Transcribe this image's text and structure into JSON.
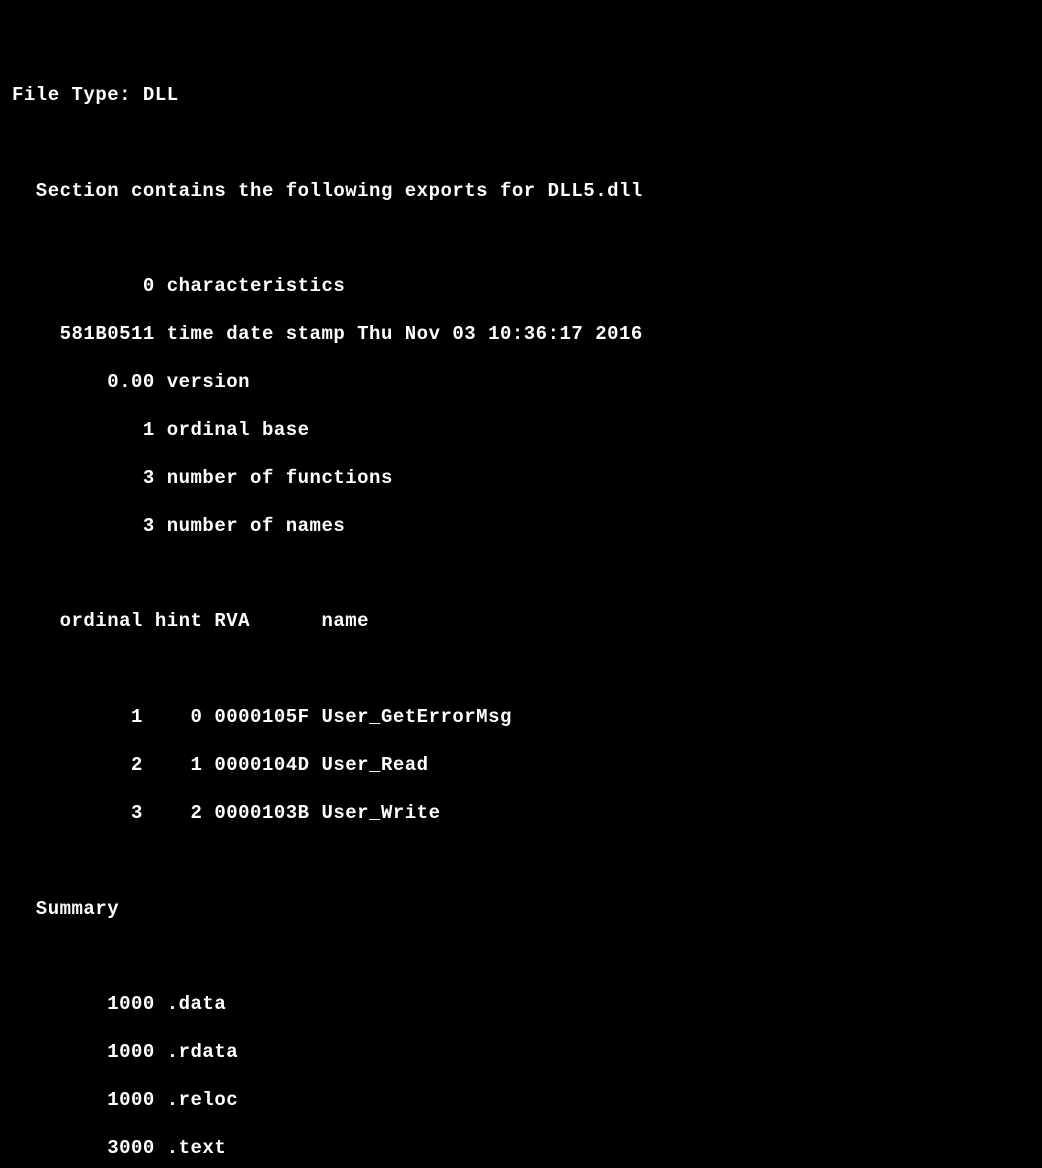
{
  "header": {
    "file_type_label": "File Type: ",
    "file_type_value": "DLL"
  },
  "section_line": "  Section contains the following exports for DLL5.dll",
  "stats": {
    "characteristics": "           0 characteristics",
    "timedate": "    581B0511 time date stamp Thu Nov 03 10:36:17 2016",
    "version": "        0.00 version",
    "ordinal_base": "           1 ordinal base",
    "num_functions": "           3 number of functions",
    "num_names": "           3 number of names"
  },
  "table": {
    "header": "    ordinal hint RVA      name",
    "row1": "          1    0 0000105F User_GetErrorMsg",
    "row2": "          2    1 0000104D User_Read",
    "row3": "          3    2 0000103B User_Write"
  },
  "summary": {
    "title": "  Summary",
    "data": "        1000 .data",
    "rdata": "        1000 .rdata",
    "reloc": "        1000 .reloc",
    "text": "        3000 .text"
  }
}
